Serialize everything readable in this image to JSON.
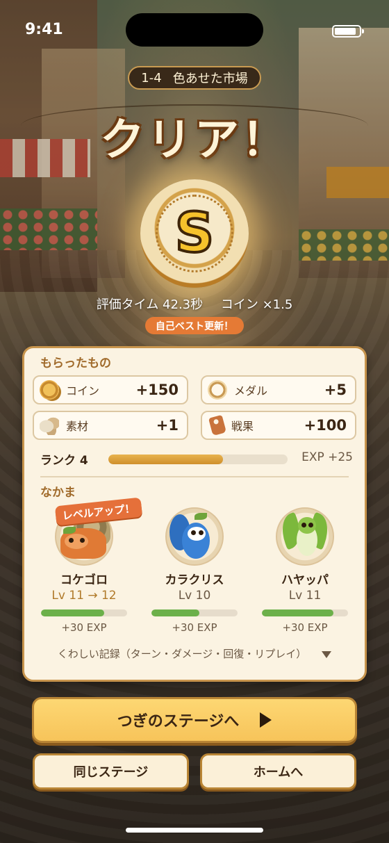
{
  "status_bar": {
    "time": "9:41"
  },
  "stage": {
    "number": "1-4",
    "name": "色あせた市場"
  },
  "result": {
    "title": "クリア！",
    "grade": "S",
    "eval_time": "評価タイム 42.3秒",
    "coin_multiplier": "コイン ×1.5",
    "best_badge": "自己ベスト更新！"
  },
  "rewards": {
    "section_label": "もらったもの",
    "items": [
      {
        "label": "コイン",
        "value": "+150",
        "icon": "coin-icon"
      },
      {
        "label": "メダル",
        "value": "+5",
        "icon": "medal-icon"
      },
      {
        "label": "素材",
        "value": "+1",
        "icon": "material-icon"
      },
      {
        "label": "戦果",
        "value": "+100",
        "icon": "spoils-tag-icon"
      }
    ]
  },
  "rank": {
    "label": "ランク 4",
    "progress": 0.64,
    "exp": "EXP +25"
  },
  "party": {
    "section_label": "なかま",
    "level_up_badge": "レベルアップ！",
    "members": [
      {
        "name": "コケゴロ",
        "level": "Lv 11 → 12",
        "exp": "+30 EXP",
        "progress": 0.73
      },
      {
        "name": "カラクリス",
        "level": "Lv 10",
        "exp": "+30 EXP",
        "progress": 0.56
      },
      {
        "name": "ハヤッパ",
        "level": "Lv 11",
        "exp": "+30 EXP",
        "progress": 0.83
      }
    ]
  },
  "details_link": "くわしい記録（ターン・ダメージ・回復・リプレイ）",
  "buttons": {
    "next_stage": "つぎのステージへ",
    "retry": "同じステージ",
    "home": "ホームへ"
  },
  "colors": {
    "accent": "#f7c45a",
    "panel": "#fbf3e2",
    "badge": "#e5703a",
    "hp": "#6cb04a"
  }
}
